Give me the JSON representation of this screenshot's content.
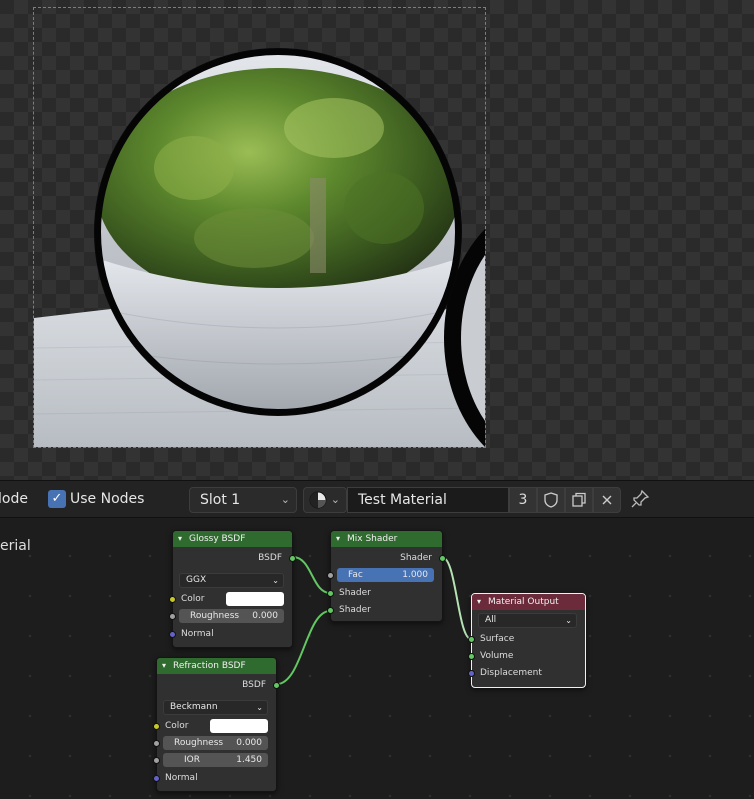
{
  "header": {
    "editor_type_partial": "lode",
    "use_nodes_label": "Use Nodes",
    "slot_label": "Slot 1",
    "material_name": "Test Material",
    "user_count": "3"
  },
  "editor": {
    "side_label_partial": "erial"
  },
  "nodes": {
    "glossy": {
      "title": "Glossy BSDF",
      "output": "BSDF",
      "distribution": "GGX",
      "color_label": "Color",
      "roughness_label": "Roughness",
      "roughness_value": "0.000",
      "normal_label": "Normal"
    },
    "mix": {
      "title": "Mix Shader",
      "output": "Shader",
      "fac_label": "Fac",
      "fac_value": "1.000",
      "shader1_label": "Shader",
      "shader2_label": "Shader"
    },
    "output": {
      "title": "Material Output",
      "target": "All",
      "surface_label": "Surface",
      "volume_label": "Volume",
      "displacement_label": "Displacement"
    },
    "refraction": {
      "title": "Refraction BSDF",
      "output": "BSDF",
      "distribution": "Beckmann",
      "color_label": "Color",
      "roughness_label": "Roughness",
      "roughness_value": "0.000",
      "ior_label": "IOR",
      "ior_value": "1.450",
      "normal_label": "Normal"
    }
  },
  "colors": {
    "shader_socket": "#63c763",
    "color_socket": "#c7c729",
    "value_socket": "#a1a1a1",
    "vector_socket": "#6363c7",
    "accent": "#4772b3",
    "shader_header": "#2f6a2f",
    "output_header": "#6b2b3a"
  },
  "icons": {
    "material_browse": "material-sphere-icon",
    "fake_user": "shield-icon",
    "duplicate": "duplicate-icon",
    "unlink": "close-icon",
    "pin": "pin-icon"
  }
}
